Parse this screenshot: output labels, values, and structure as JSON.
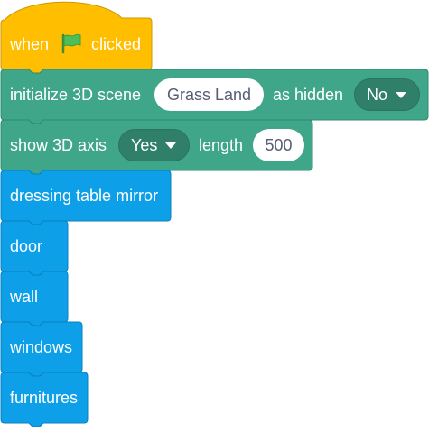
{
  "colors": {
    "events": "#ffbf00",
    "events_border": "#cc9900",
    "extension": "#3fa68a",
    "extension_border": "#2e8a70",
    "extension_dropdown": "#2f7f69",
    "looks": "#0d9fe8",
    "looks_border": "#0a80c0",
    "flag": "#4cbf56"
  },
  "hat": {
    "when_label": "when",
    "flag_icon": "green-flag-icon",
    "clicked_label": "clicked"
  },
  "init_scene": {
    "label": "initialize 3D scene",
    "scene_value": "Grass Land",
    "hidden_label": "as hidden",
    "hidden_value": "No"
  },
  "show_axis": {
    "label": "show 3D axis",
    "axis_value": "Yes",
    "length_label": "length",
    "length_value": "500"
  },
  "custom_blocks": [
    {
      "label": "dressing table mirror"
    },
    {
      "label": "door"
    },
    {
      "label": "wall"
    },
    {
      "label": "windows"
    },
    {
      "label": "furnitures"
    }
  ]
}
